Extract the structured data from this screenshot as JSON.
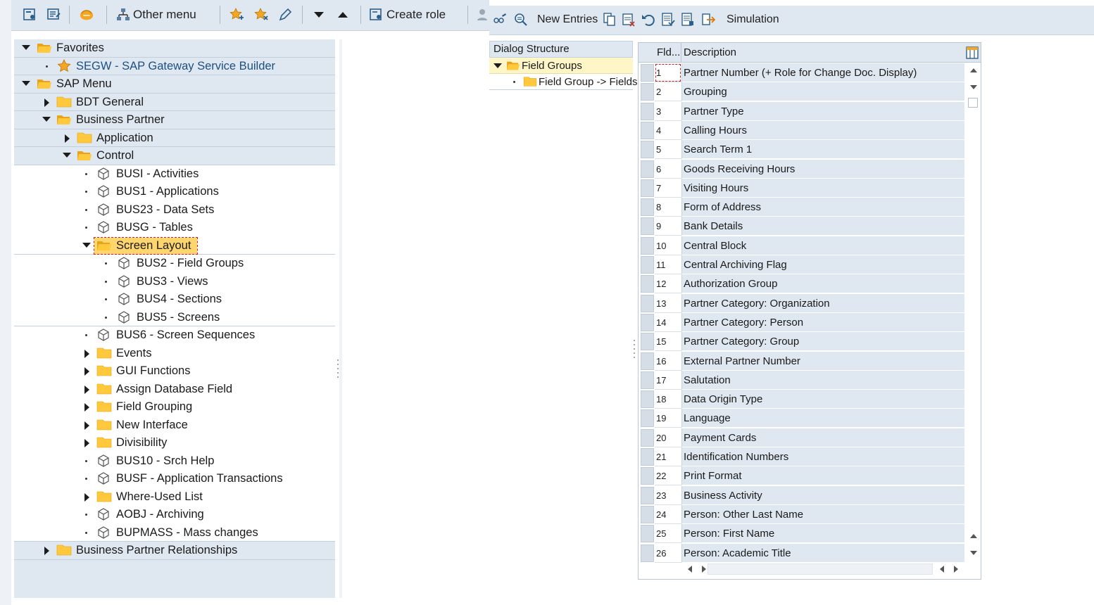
{
  "left_toolbar": {
    "other_menu_label": "Other menu",
    "create_role_label": "Create role"
  },
  "tree": {
    "favorites": "Favorites",
    "segw": "SEGW - SAP Gateway Service Builder",
    "sap_menu": "SAP Menu",
    "bdt_general": "BDT General",
    "business_partner": "Business Partner",
    "application": "Application",
    "control": "Control",
    "busi": "BUSI - Activities",
    "bus1": "BUS1 - Applications",
    "bus23": "BUS23 - Data Sets",
    "busg": "BUSG - Tables",
    "screen_layout": "Screen Layout",
    "bus2": "BUS2 - Field Groups",
    "bus3": "BUS3 - Views",
    "bus4": "BUS4 - Sections",
    "bus5": "BUS5 - Screens",
    "bus6": "BUS6 - Screen Sequences",
    "events": "Events",
    "gui_functions": "GUI Functions",
    "assign_db_field": "Assign Database Field",
    "field_grouping": "Field Grouping",
    "new_interface": "New Interface",
    "divisibility": "Divisibility",
    "bus10": "BUS10 - Srch Help",
    "busf": "BUSF - Application Transactions",
    "where_used": "Where-Used List",
    "aobj": "AOBJ - Archiving",
    "bupmass": "BUPMASS - Mass changes",
    "bp_relationships": "Business Partner Relationships"
  },
  "right_toolbar": {
    "new_entries_label": "New Entries",
    "simulation_label": "Simulation"
  },
  "dialog_structure": {
    "header": "Dialog Structure",
    "field_groups": "Field Groups",
    "field_group_fields": "Field Group -> Fields"
  },
  "table": {
    "col_fld": "Fld...",
    "col_description": "Description",
    "rows": [
      {
        "fld": "1",
        "desc": "Partner Number (+ Role for Change Doc. Display)"
      },
      {
        "fld": "2",
        "desc": "Grouping"
      },
      {
        "fld": "3",
        "desc": "Partner Type"
      },
      {
        "fld": "4",
        "desc": "Calling Hours"
      },
      {
        "fld": "5",
        "desc": "Search Term 1"
      },
      {
        "fld": "6",
        "desc": "Goods Receiving Hours"
      },
      {
        "fld": "7",
        "desc": "Visiting Hours"
      },
      {
        "fld": "8",
        "desc": "Form of Address"
      },
      {
        "fld": "9",
        "desc": "Bank Details"
      },
      {
        "fld": "10",
        "desc": "Central Block"
      },
      {
        "fld": "11",
        "desc": "Central Archiving Flag"
      },
      {
        "fld": "12",
        "desc": "Authorization Group"
      },
      {
        "fld": "13",
        "desc": "Partner Category: Organization"
      },
      {
        "fld": "14",
        "desc": "Partner Category: Person"
      },
      {
        "fld": "15",
        "desc": "Partner Category: Group"
      },
      {
        "fld": "16",
        "desc": "External Partner Number"
      },
      {
        "fld": "17",
        "desc": "Salutation"
      },
      {
        "fld": "18",
        "desc": "Data Origin Type"
      },
      {
        "fld": "19",
        "desc": "Language"
      },
      {
        "fld": "20",
        "desc": "Payment Cards"
      },
      {
        "fld": "21",
        "desc": "Identification Numbers"
      },
      {
        "fld": "22",
        "desc": "Print Format"
      },
      {
        "fld": "23",
        "desc": "Business Activity"
      },
      {
        "fld": "24",
        "desc": "Person: Other Last Name"
      },
      {
        "fld": "25",
        "desc": "Person: First Name"
      },
      {
        "fld": "26",
        "desc": "Person: Academic Title"
      }
    ]
  },
  "colors": {
    "pane_blue": "#dfe8f1",
    "folder_yellow": "#ffc83d",
    "highlight_yellow": "#ffd66e",
    "focus_red": "#d81b1b"
  },
  "icons": {
    "folder": "folder-icon",
    "cube": "transaction-cube-icon",
    "favorite": "star-icon"
  }
}
